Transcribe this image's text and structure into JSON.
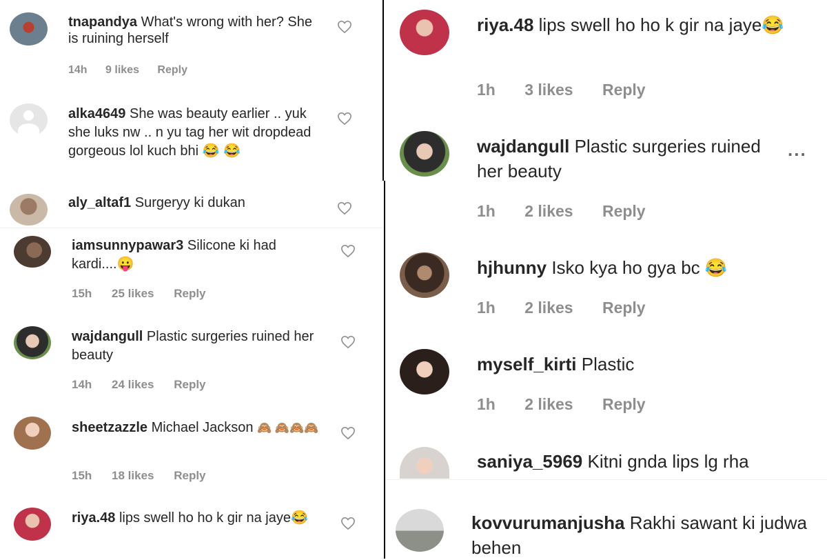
{
  "left": [
    {
      "id": "c1",
      "username": "tnapandya",
      "text": "What's wrong with her? She is ruining herself",
      "time": "14h",
      "likes": "9 likes",
      "reply": "Reply"
    },
    {
      "id": "c2",
      "username": "alka4649",
      "text": "She was beauty earlier .. yuk she luks nw .. n yu tag her wit dropdead gorgeous lol kuch bhi",
      "emoji": "😂 😂"
    },
    {
      "id": "c3",
      "username": "aly_altaf1",
      "text": "Surgeryy ki dukan"
    },
    {
      "id": "c4",
      "username": "iamsunnypawar3",
      "text": "Silicone ki had kardi....",
      "emoji": "😛",
      "time": "15h",
      "likes": "25 likes",
      "reply": "Reply"
    },
    {
      "id": "c5",
      "username": "wajdangull",
      "text": "Plastic surgeries ruined her beauty",
      "time": "14h",
      "likes": "24 likes",
      "reply": "Reply"
    },
    {
      "id": "c6",
      "username": "sheetzazzle",
      "text": "Michael Jackson",
      "emoji": "🙈 🙈🙈🙈",
      "time": "15h",
      "likes": "18 likes",
      "reply": "Reply"
    },
    {
      "id": "c7",
      "username": "riya.48",
      "text": "lips swell ho ho k gir na jaye",
      "emoji": "😂"
    }
  ],
  "right": [
    {
      "id": "r1",
      "username": "riya.48",
      "text": "lips swell ho ho k gir na jaye",
      "emoji": "😂",
      "time": "1h",
      "likes": "3 likes",
      "reply": "Reply"
    },
    {
      "id": "r2",
      "username": "wajdangull",
      "text": "Plastic surgeries ruined her beauty",
      "time": "1h",
      "likes": "2 likes",
      "reply": "Reply",
      "more": "..."
    },
    {
      "id": "r3",
      "username": "hjhunny",
      "text": "Isko kya ho gya bc",
      "emoji": "😂",
      "time": "1h",
      "likes": "2 likes",
      "reply": "Reply"
    },
    {
      "id": "r4",
      "username": "myself_kirti",
      "text": "Plastic",
      "time": "1h",
      "likes": "2 likes",
      "reply": "Reply"
    },
    {
      "id": "r5",
      "username": "saniya_5969",
      "text": "Kitni gnda lips lg rha"
    },
    {
      "id": "r6",
      "username": "kovvurumanjusha",
      "text": "Rakhi sawant ki judwa behen"
    }
  ],
  "colors": {
    "meta": "#8e8e8e",
    "text": "#262626",
    "divider": "#000000",
    "heart": "#8e8e8e"
  }
}
